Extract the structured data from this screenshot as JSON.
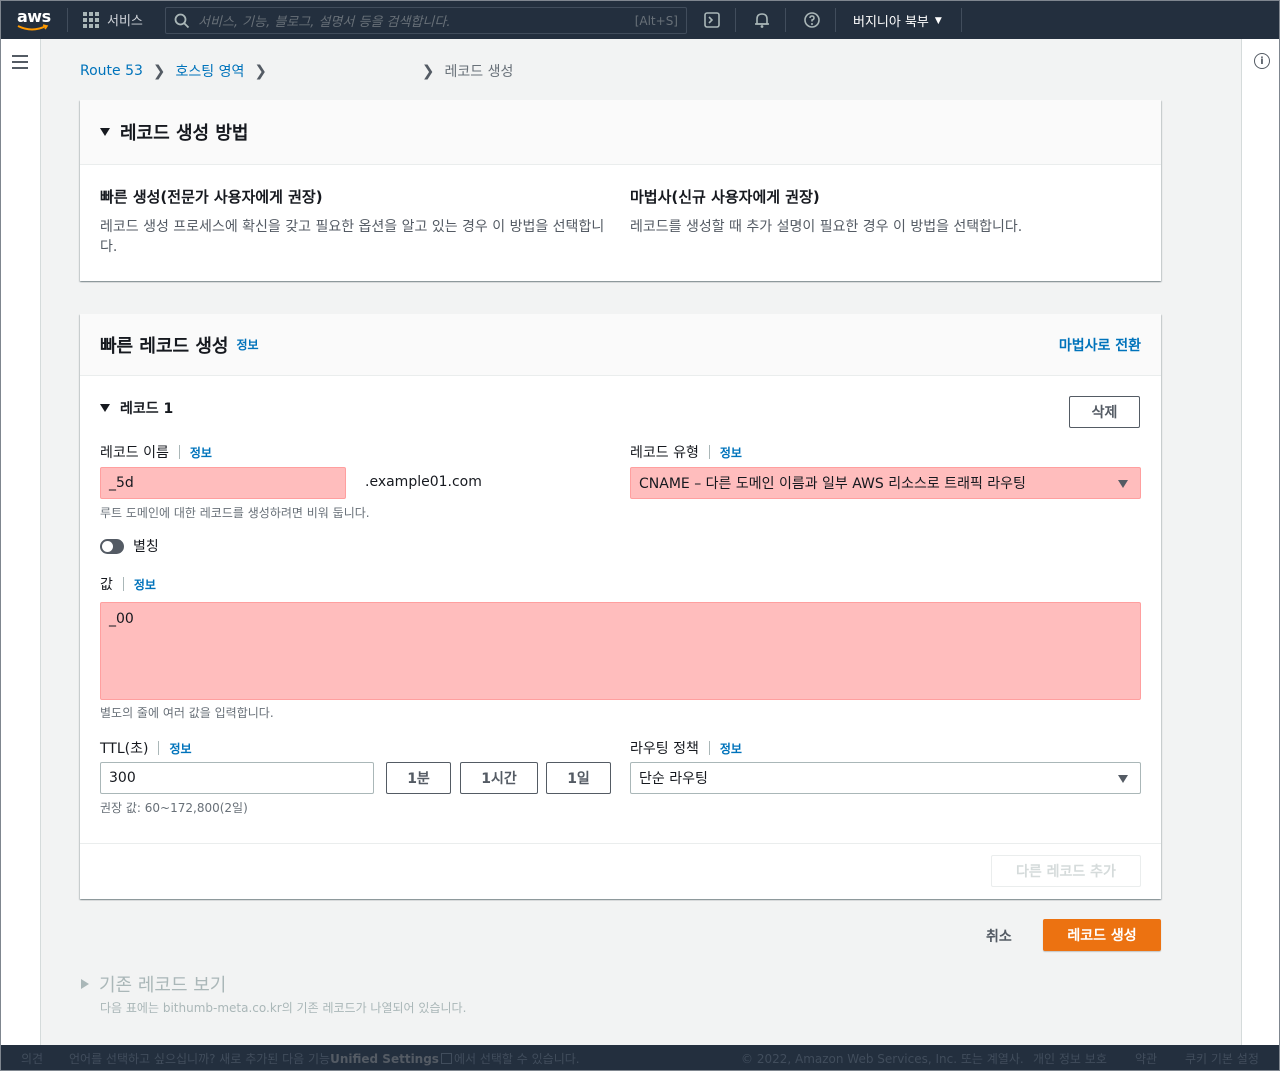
{
  "nav": {
    "logo": "aws",
    "services": "서비스",
    "search_placeholder": "서비스, 기능, 블로그, 설명서 등을 검색합니다.",
    "search_shortcut": "[Alt+S]",
    "region": "버지니아 북부"
  },
  "breadcrumb": {
    "route53": "Route 53",
    "hosted_zones": "호스팅 영역",
    "current": "레코드 생성"
  },
  "method_panel": {
    "title": "레코드 생성 방법",
    "quick_title": "빠른 생성(전문가 사용자에게 권장)",
    "quick_desc": "레코드 생성 프로세스에 확신을 갖고 필요한 옵션을 알고 있는 경우 이 방법을 선택합니다.",
    "wizard_title": "마법사(신규 사용자에게 권장)",
    "wizard_desc": "레코드를 생성할 때 추가 설명이 필요한 경우 이 방법을 선택합니다."
  },
  "quick_panel": {
    "title": "빠른 레코드 생성",
    "info": "정보",
    "switch_wizard": "마법사로 전환",
    "record_section": "레코드 1",
    "delete": "삭제",
    "record_name_label": "레코드 이름",
    "record_name_value": "_5d",
    "domain_suffix": ".example01.com",
    "record_name_hint": "루트 도메인에 대한 레코드를 생성하려면 비워 둡니다.",
    "record_type_label": "레코드 유형",
    "record_type_value": "CNAME – 다른 도메인 이름과 일부 AWS 리소스로 트래픽 라우팅",
    "alias_label": "별칭",
    "alias_on": false,
    "value_label": "값",
    "value_value": "_00",
    "value_hint": "별도의 줄에 여러 값을 입력합니다.",
    "ttl_label": "TTL(초)",
    "ttl_value": "300",
    "ttl_1m": "1분",
    "ttl_1h": "1시간",
    "ttl_1d": "1일",
    "ttl_hint": "권장 값: 60~172,800(2일)",
    "routing_label": "라우팅 정책",
    "routing_value": "단순 라우팅",
    "add_record": "다른 레코드 추가"
  },
  "actions": {
    "cancel": "취소",
    "create": "레코드 생성"
  },
  "existing": {
    "title": "기존 레코드 보기",
    "desc": "다음 표에는 bithumb-meta.co.kr의 기존 레코드가 나열되어 있습니다."
  },
  "footer": {
    "feedback": "의견",
    "language": "언어를 선택하고 싶으십니까? 새로 추가된 다음 기능",
    "unified": "Unified Settings",
    "language_tail": "에서 선택할 수 있습니다.",
    "copyright": "© 2022, Amazon Web Services, Inc. 또는 계열사.",
    "privacy": "개인 정보 보호",
    "terms": "약관",
    "cookies": "쿠키 기본 설정"
  }
}
